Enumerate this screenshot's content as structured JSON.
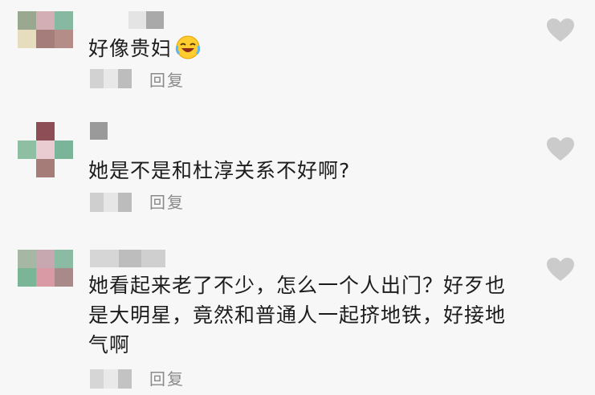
{
  "comments": [
    {
      "text": "好像贵妇",
      "reply_label": "回复",
      "emoji": "laughing-crying-emoji"
    },
    {
      "text": "她是不是和杜淳关系不好啊?",
      "reply_label": "回复"
    },
    {
      "text": "她看起来老了不少，怎么一个人出门？好歹也是大明星，竟然和普通人一起挤地铁，好接地气啊",
      "reply_label": "回复"
    }
  ],
  "icons": {
    "like": "heart-icon"
  },
  "colors": {
    "background": "#f7f7f7",
    "reply_text": "#8a8a8a",
    "heart": "#c9c9c9"
  }
}
